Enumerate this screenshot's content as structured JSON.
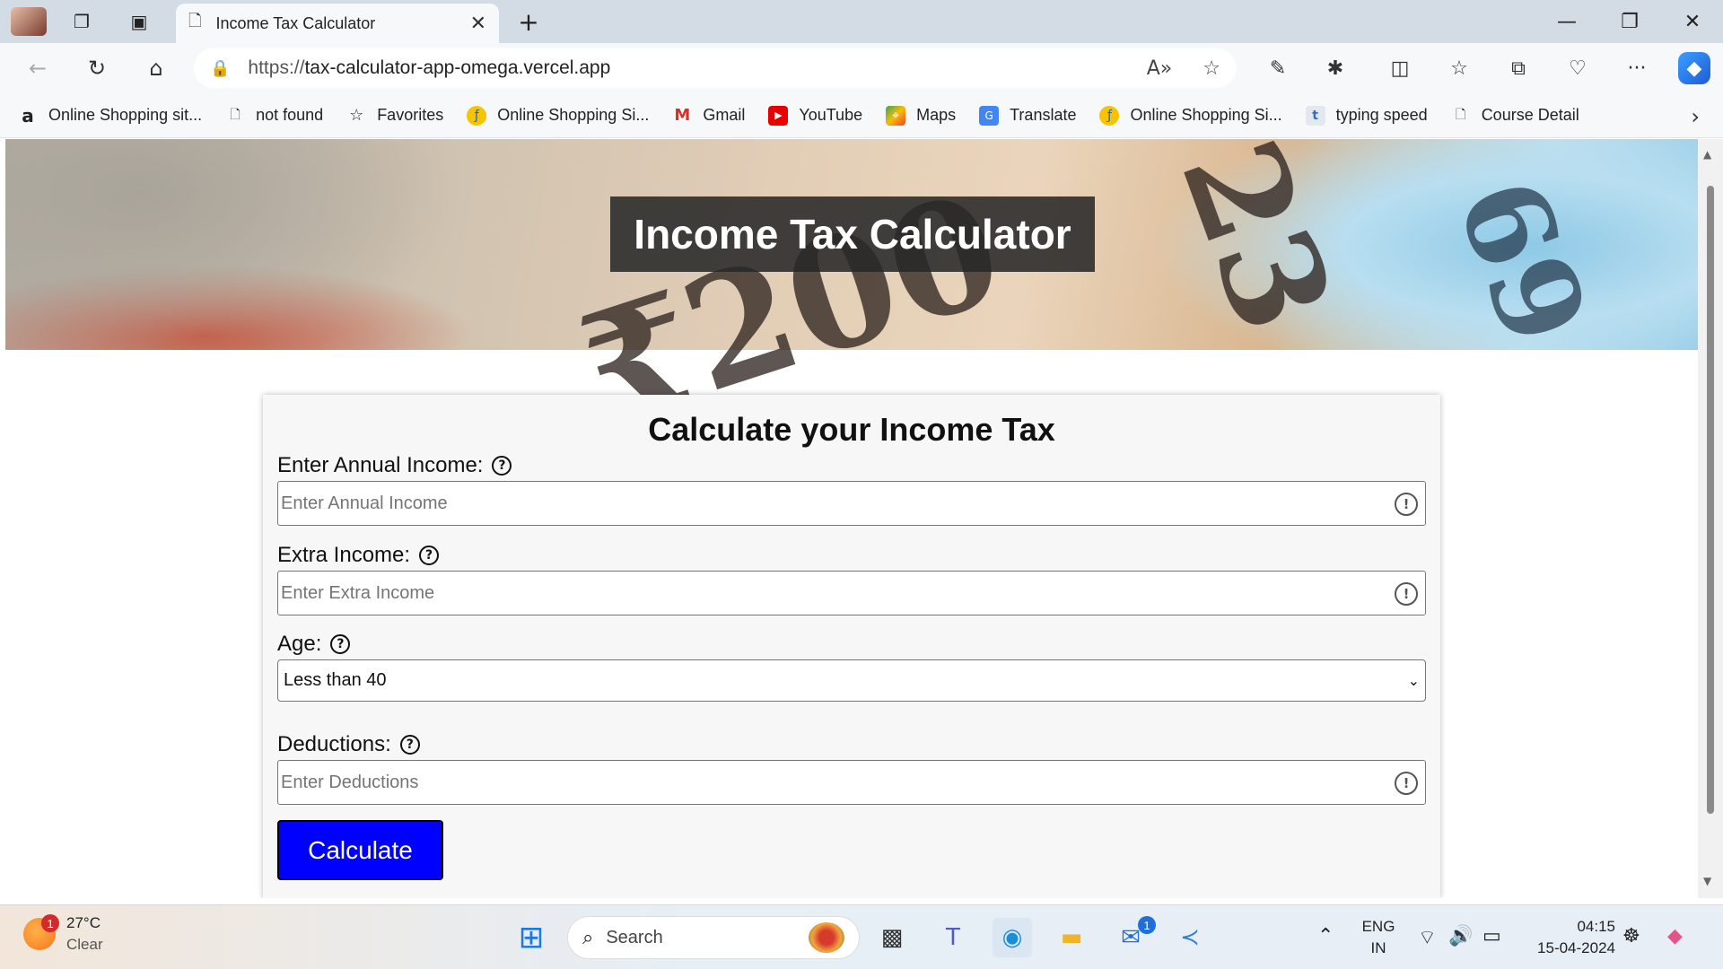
{
  "browser": {
    "tab_title": "Income Tax Calculator",
    "url_protocol": "https://",
    "url_host": "tax-calculator-app-omega.vercel.app",
    "bookmarks": [
      {
        "label": "Online Shopping sit...",
        "icon": "amazon-icon"
      },
      {
        "label": "not found",
        "icon": "page-icon"
      },
      {
        "label": "Favorites",
        "icon": "star-icon"
      },
      {
        "label": "Online Shopping Si...",
        "icon": "flipkart-icon"
      },
      {
        "label": "Gmail",
        "icon": "gmail-icon"
      },
      {
        "label": "YouTube",
        "icon": "youtube-icon"
      },
      {
        "label": "Maps",
        "icon": "maps-icon"
      },
      {
        "label": "Translate",
        "icon": "translate-icon"
      },
      {
        "label": "Online Shopping Si...",
        "icon": "flipkart-icon"
      },
      {
        "label": "typing speed",
        "icon": "typing-icon"
      },
      {
        "label": "Course Detail",
        "icon": "page-icon"
      }
    ]
  },
  "page": {
    "hero_title": "Income Tax Calculator",
    "form_title": "Calculate your Income Tax",
    "fields": {
      "annual_income": {
        "label": "Enter Annual Income:",
        "placeholder": "Enter Annual Income",
        "value": ""
      },
      "extra_income": {
        "label": "Extra Income:",
        "placeholder": "Enter Extra Income",
        "value": ""
      },
      "age": {
        "label": "Age:",
        "selected": "Less than 40"
      },
      "deductions": {
        "label": "Deductions:",
        "placeholder": "Enter Deductions",
        "value": ""
      }
    },
    "calculate_label": "Calculate",
    "accent_color": "#0000ff"
  },
  "taskbar": {
    "temperature": "27°C",
    "condition": "Clear",
    "weather_badge": "1",
    "search_placeholder": "Search",
    "mail_badge": "1",
    "lang_top": "ENG",
    "lang_bottom": "IN",
    "time": "04:15",
    "date": "15-04-2024"
  }
}
